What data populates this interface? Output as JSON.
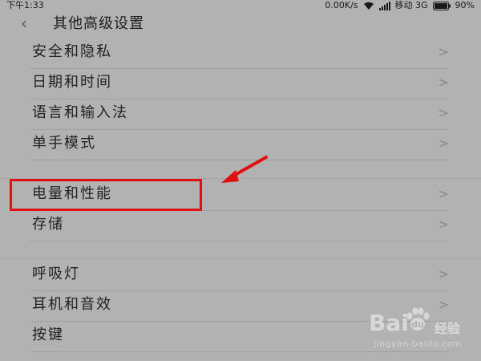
{
  "status": {
    "time": "下午1:33",
    "network_speed": "0.00K/s",
    "carrier": "移动 3G",
    "battery": "90%"
  },
  "header": {
    "back_icon": "chevron-left-icon",
    "title": "其他高级设置"
  },
  "items": [
    {
      "label": "安全和隐私",
      "chevron": ">"
    },
    {
      "label": "日期和时间",
      "chevron": ">"
    },
    {
      "label": "语言和输入法",
      "chevron": ">"
    },
    {
      "label": "单手模式",
      "chevron": ">"
    },
    {
      "label": "电量和性能",
      "chevron": ">"
    },
    {
      "label": "存储",
      "chevron": ">"
    },
    {
      "label": "呼吸灯",
      "chevron": ">"
    },
    {
      "label": "耳机和音效",
      "chevron": ">"
    },
    {
      "label": "按键",
      "chevron": ""
    }
  ],
  "annotation": {
    "highlight_color": "#e01010",
    "highlighted_item": "电量和性能"
  },
  "watermark": {
    "logo_text": "Bai",
    "logo_suffix": "",
    "site": "经验",
    "url": "jingyan.baidu.com"
  }
}
